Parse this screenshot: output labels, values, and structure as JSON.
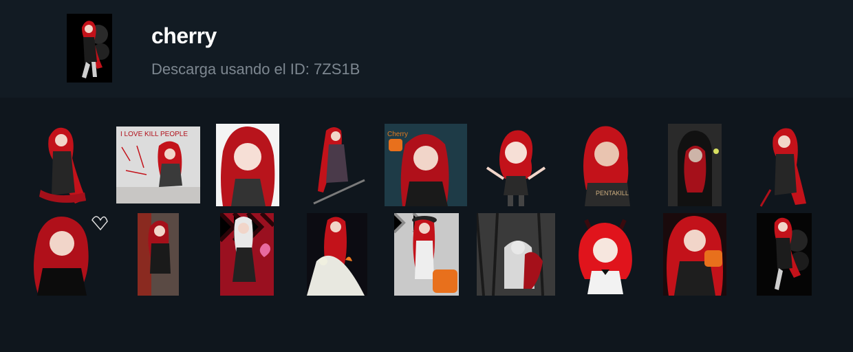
{
  "pack": {
    "name": "cherry",
    "subtitle": "Descarga usando el ID: 7ZS1B"
  },
  "stickers_row1": [
    {
      "name": "sticker-1",
      "bg": "transparent",
      "hair": "#c3121a"
    },
    {
      "name": "sticker-2",
      "bg": "#dcdcdc",
      "hair": "#c3121a",
      "caption": "I LOVE KILL PEOPLE"
    },
    {
      "name": "sticker-3",
      "bg": "#f4f4f4",
      "hair": "#b8141c"
    },
    {
      "name": "sticker-4",
      "bg": "transparent",
      "hair": "#c3121a"
    },
    {
      "name": "sticker-5",
      "bg": "#1e3b47",
      "hair": "#b0101a",
      "caption": "Cherry"
    },
    {
      "name": "sticker-6",
      "bg": "transparent",
      "hair": "#c3121a"
    },
    {
      "name": "sticker-7",
      "bg": "transparent",
      "hair": "#c3121a",
      "caption": "PENTAKILL"
    },
    {
      "name": "sticker-8",
      "bg": "#2a2a2a",
      "hair": "#a5101a"
    },
    {
      "name": "sticker-9",
      "bg": "transparent",
      "hair": "#c3121a"
    }
  ],
  "stickers_row2": [
    {
      "name": "sticker-10",
      "bg": "transparent",
      "hair": "#b0101a"
    },
    {
      "name": "sticker-11",
      "bg": "#5a4a44",
      "hair": "#a5101a"
    },
    {
      "name": "sticker-12",
      "bg": "#9a1020",
      "hair": "#e8e8e8"
    },
    {
      "name": "sticker-13",
      "bg": "#0c0c12",
      "hair": "#c3121a"
    },
    {
      "name": "sticker-14",
      "bg": "#c9c9c9",
      "hair": "#c3121a"
    },
    {
      "name": "sticker-15",
      "bg": "#3a3a3a",
      "hair": "#a5101a"
    },
    {
      "name": "sticker-16",
      "bg": "transparent",
      "hair": "#e0141c"
    },
    {
      "name": "sticker-17",
      "bg": "#1a0a0c",
      "hair": "#c3121a"
    },
    {
      "name": "sticker-18",
      "bg": "#050505",
      "hair": "#c3121a"
    }
  ]
}
